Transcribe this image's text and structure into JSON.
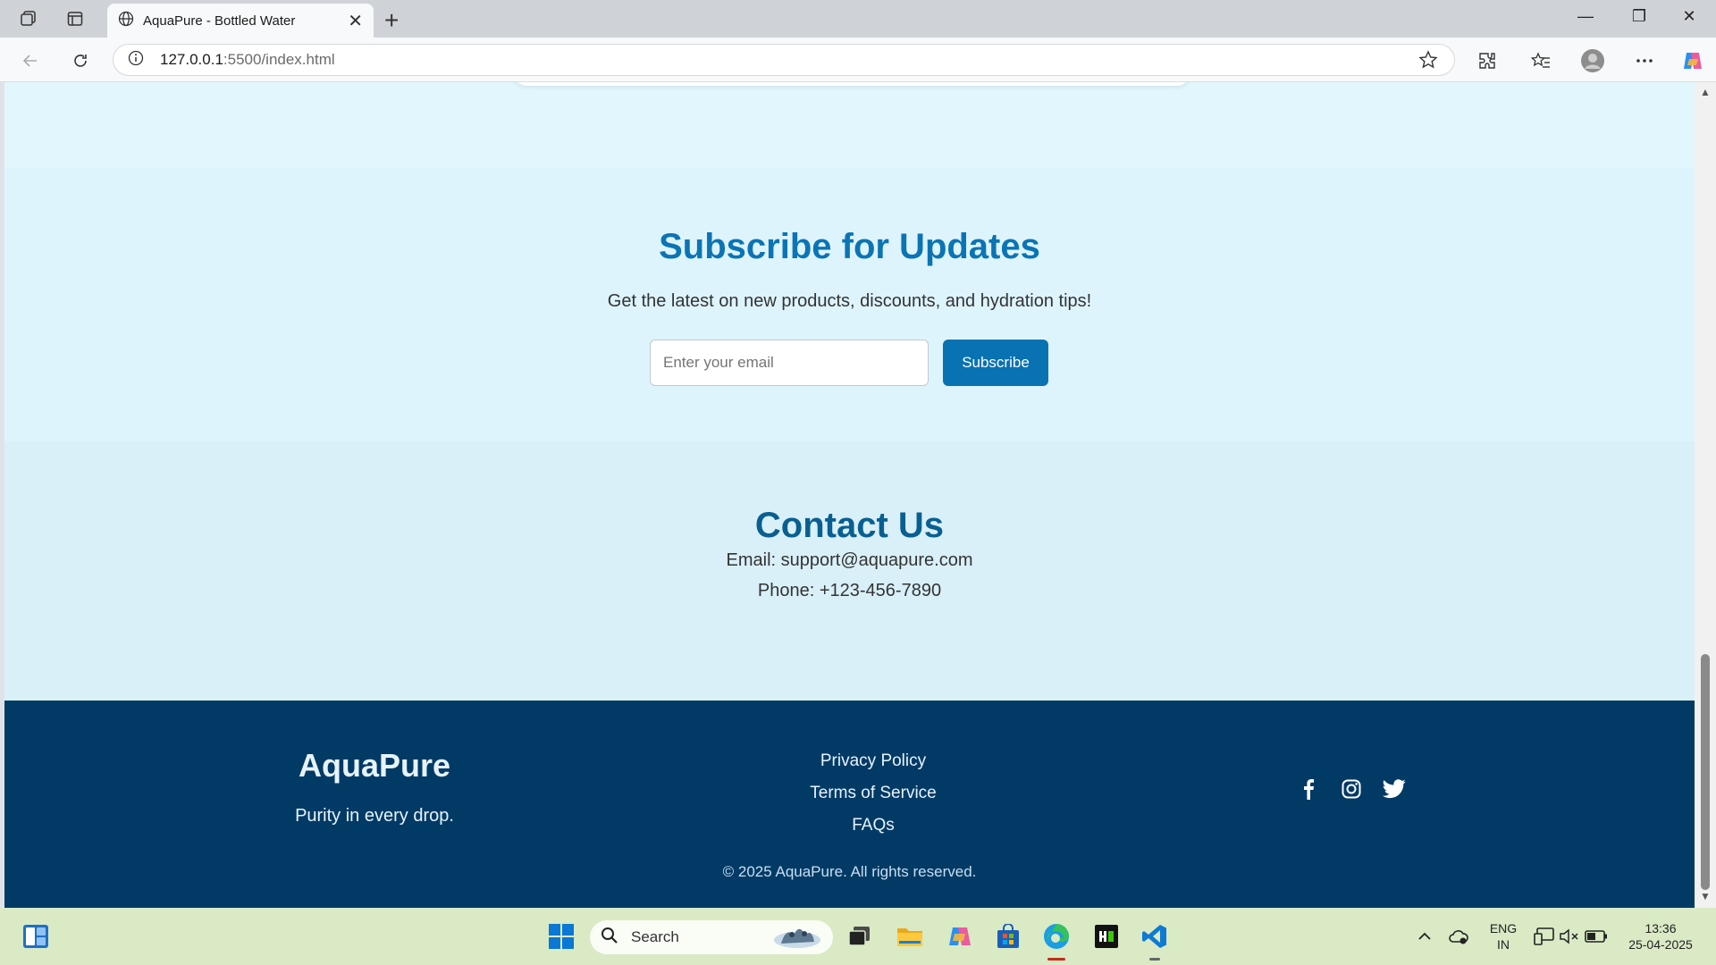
{
  "browser": {
    "tab_title": "AquaPure - Bottled Water",
    "url_host": "127.0.0.1",
    "url_rest": ":5500/index.html"
  },
  "subscribe": {
    "title": "Subscribe for Updates",
    "subtitle": "Get the latest on new products, discounts, and hydration tips!",
    "email_placeholder": "Enter your email",
    "button_label": "Subscribe"
  },
  "contact": {
    "title": "Contact Us",
    "email_line": "Email: support@aquapure.com",
    "phone_line": "Phone: +123-456-7890"
  },
  "footer": {
    "brand": "AquaPure",
    "tagline": "Purity in every drop.",
    "links": [
      "Privacy Policy",
      "Terms of Service",
      "FAQs"
    ],
    "social_icons": [
      "facebook-icon",
      "instagram-icon",
      "twitter-icon"
    ],
    "copyright": "© 2025 AquaPure. All rights reserved."
  },
  "taskbar": {
    "search_label": "Search",
    "lang_top": "ENG",
    "lang_bottom": "IN",
    "time": "13:36",
    "date": "25-04-2025"
  },
  "colors": {
    "primary": "#0872b3",
    "heading_blue": "#0b74b5",
    "footer_bg": "#023a66"
  }
}
